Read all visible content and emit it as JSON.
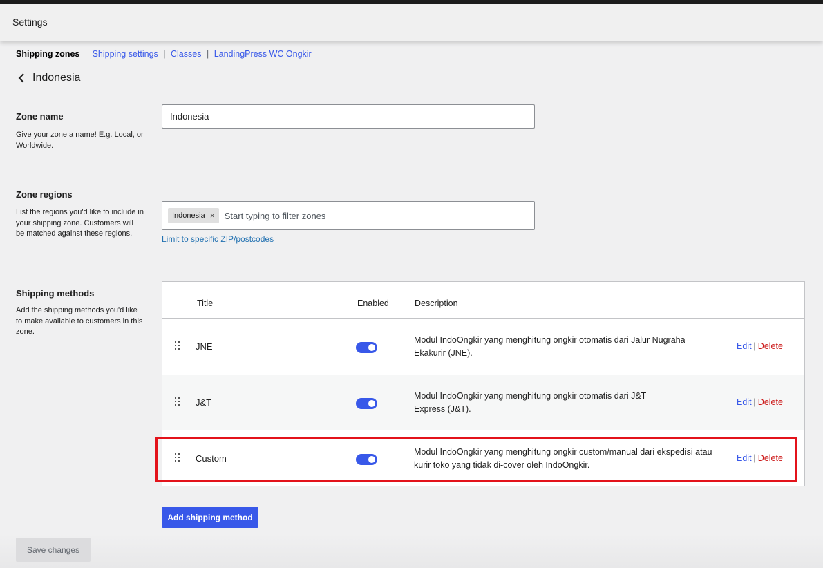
{
  "header": {
    "title": "Settings"
  },
  "subnav": {
    "current": "Shipping zones",
    "links": [
      "Shipping settings",
      "Classes",
      "LandingPress WC Ongkir"
    ]
  },
  "zone": {
    "title": "Indonesia"
  },
  "zone_name": {
    "label": "Zone name",
    "help": "Give your zone a name! E.g. Local, or Worldwide.",
    "value": "Indonesia"
  },
  "zone_regions": {
    "label": "Zone regions",
    "help": "List the regions you'd like to include in your shipping zone. Customers will be matched against these regions.",
    "chip": "Indonesia",
    "chip_remove": "×",
    "placeholder": "Start typing to filter zones",
    "zip_link": "Limit to specific ZIP/postcodes"
  },
  "shipping_methods": {
    "label": "Shipping methods",
    "help": "Add the shipping methods you'd like to make available to customers in this zone.",
    "columns": {
      "title": "Title",
      "enabled": "Enabled",
      "description": "Description"
    },
    "rows": [
      {
        "title": "JNE",
        "enabled": true,
        "description": "Modul IndoOngkir yang menghitung ongkir otomatis dari Jalur Nugraha Ekakurir (JNE).",
        "edit": "Edit",
        "sep": "|",
        "delete": "Delete"
      },
      {
        "title": "J&T",
        "enabled": true,
        "description": "Modul IndoOngkir yang menghitung ongkir otomatis dari J&T Express (J&T).",
        "edit": "Edit",
        "sep": "|",
        "delete": "Delete"
      },
      {
        "title": "Custom",
        "enabled": true,
        "description": "Modul IndoOngkir yang menghitung ongkir custom/manual dari ekspedisi atau kurir toko yang tidak di-cover oleh IndoOngkir.",
        "edit": "Edit",
        "sep": "|",
        "delete": "Delete"
      }
    ],
    "add_button": "Add shipping method"
  },
  "footer": {
    "save_button": "Save changes"
  },
  "colors": {
    "accent": "#3858e9",
    "delete": "#cc1818",
    "highlight": "#e3131b"
  },
  "icons": {
    "back": "chevron-left-icon",
    "drag": "drag-handle-icon"
  }
}
